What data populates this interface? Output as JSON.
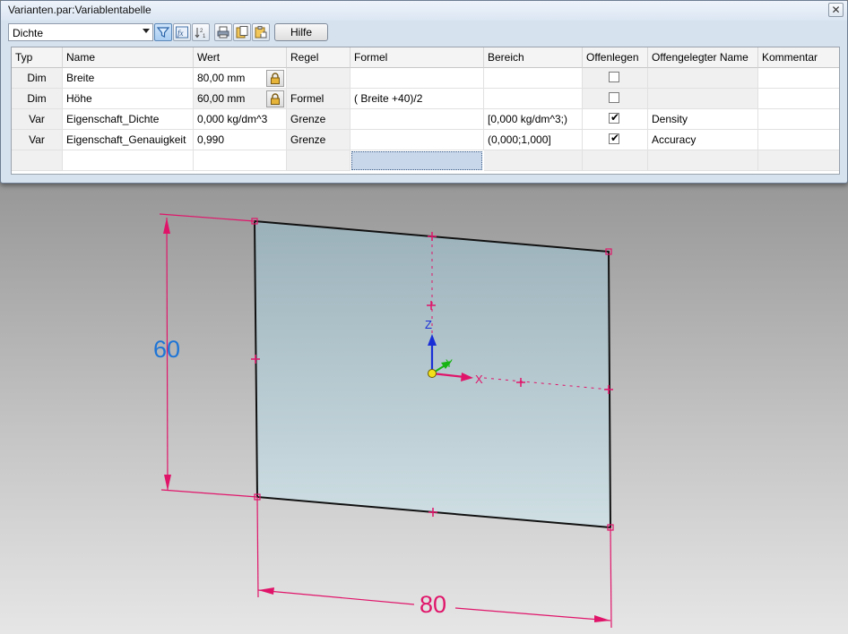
{
  "window": {
    "title": "Varianten.par:Variablentabelle",
    "close_glyph": "✕"
  },
  "toolbar": {
    "filter_value": "Dichte",
    "help_label": "Hilfe",
    "icons": [
      "filter-icon",
      "formula-icon",
      "sort-icon",
      "print-icon",
      "copy-icon",
      "paste-icon"
    ]
  },
  "table": {
    "columns": [
      "Typ",
      "Name",
      "Wert",
      "Regel",
      "Formel",
      "Bereich",
      "Offenlegen",
      "Offengelegter Name",
      "Kommentar"
    ],
    "rows": [
      {
        "typ": "Dim",
        "name": "Breite",
        "wert": "80,00 mm",
        "locked": true,
        "regel": "",
        "formel": "",
        "bereich": "",
        "offenlegen": false,
        "offengelegter_name": "",
        "kommentar": ""
      },
      {
        "typ": "Dim",
        "name": "Höhe",
        "wert": "60,00 mm",
        "locked": true,
        "regel": "Formel",
        "formel": "( Breite +40)/2",
        "bereich": "",
        "offenlegen": false,
        "offengelegter_name": "",
        "kommentar": ""
      },
      {
        "typ": "Var",
        "name": "Eigenschaft_Dichte",
        "wert": "0,000 kg/dm^3",
        "locked": false,
        "regel": "Grenze",
        "formel": "",
        "bereich": "[0,000 kg/dm^3;)",
        "offenlegen": true,
        "offengelegter_name": "Density",
        "kommentar": ""
      },
      {
        "typ": "Var",
        "name": "Eigenschaft_Genauigkeit",
        "wert": "0,990",
        "locked": false,
        "regel": "Grenze",
        "formel": "",
        "bereich": "(0,000;1,000]",
        "offenlegen": true,
        "offengelegter_name": "Accuracy",
        "kommentar": ""
      }
    ],
    "checkmark_glyph": "✔"
  },
  "viewport": {
    "dimension_height": "60",
    "dimension_width": "80",
    "axis_x": "X",
    "axis_y": "Y",
    "axis_z": "Z",
    "colors": {
      "dimension_line": "#e0156a",
      "dimension_active": "#1f75d6",
      "plate_fill_top": "#9bb1ba",
      "plate_fill_bottom": "#cfdfe4",
      "axis_z": "#1a2fd6",
      "axis_y": "#18b414",
      "axis_x": "#e0156a",
      "origin": "#f2e11a"
    }
  }
}
